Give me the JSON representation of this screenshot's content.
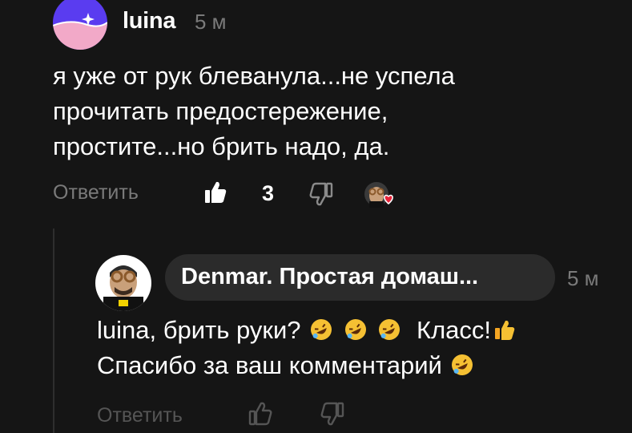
{
  "comment": {
    "author": "luina",
    "time": "5 м",
    "text": "я уже от рук блеванула...не успела\nпрочитать предостережение,\nпростите...но брить надо, да.",
    "actions": {
      "reply_label": "Ответить",
      "like_count": "3"
    }
  },
  "reply": {
    "author_label": "Denmar. Простая домаш...",
    "time": "5 м",
    "text_line1_prefix": "luina, брить руки?",
    "text_line1_suffix": "Класс!",
    "text_line2": "Спасибо за ваш комментарий",
    "actions": {
      "reply_label": "Ответить"
    }
  },
  "colors": {
    "background": "#151515",
    "primary_text": "#ffffff",
    "secondary_text": "#7a7a7a",
    "pill": "#2b2b2b",
    "avatar_purple": "#5a3cf0",
    "avatar_pink": "#f2a9c8",
    "heart": "#e8243a"
  },
  "icons": {
    "like": "thumbs-up-icon",
    "dislike": "thumbs-down-icon",
    "author_heart": "author-heart-icon",
    "laugh_emoji": "rolling-laughing-emoji",
    "thumb_emoji": "thumbs-up-emoji"
  }
}
